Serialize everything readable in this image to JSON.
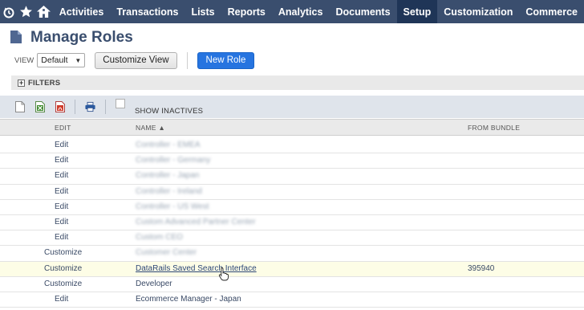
{
  "nav": {
    "items": [
      {
        "label": "Activities",
        "active": false
      },
      {
        "label": "Transactions",
        "active": false
      },
      {
        "label": "Lists",
        "active": false
      },
      {
        "label": "Reports",
        "active": false
      },
      {
        "label": "Analytics",
        "active": false
      },
      {
        "label": "Documents",
        "active": false
      },
      {
        "label": "Setup",
        "active": true
      },
      {
        "label": "Customization",
        "active": false
      },
      {
        "label": "Commerce",
        "active": false
      }
    ],
    "icons": [
      "recent-records-icon",
      "star-icon",
      "home-icon"
    ],
    "colors": {
      "bar": "#3a4e6e",
      "active": "#1f3557"
    }
  },
  "page": {
    "title": "Manage Roles"
  },
  "controls": {
    "view_label": "VIEW",
    "view_value": "Default",
    "customize_view_label": "Customize View",
    "new_role_label": "New Role"
  },
  "filters": {
    "label": "FILTERS"
  },
  "toolbar": {
    "icons": [
      "new-document-icon",
      "excel-export-icon",
      "pdf-export-icon",
      "print-icon"
    ],
    "show_inactives_label": "SHOW INACTIVES",
    "show_inactives_checked": false
  },
  "table": {
    "headers": {
      "edit": "EDIT",
      "name": "NAME ▲",
      "from_bundle": "FROM BUNDLE"
    },
    "rows": [
      {
        "action": "Edit",
        "name": "Controller - EMEA",
        "bundle": "",
        "blurred": true
      },
      {
        "action": "Edit",
        "name": "Controller - Germany",
        "bundle": "",
        "blurred": true
      },
      {
        "action": "Edit",
        "name": "Controller - Japan",
        "bundle": "",
        "blurred": true
      },
      {
        "action": "Edit",
        "name": "Controller - Ireland",
        "bundle": "",
        "blurred": true
      },
      {
        "action": "Edit",
        "name": "Controller - US West",
        "bundle": "",
        "blurred": true
      },
      {
        "action": "Edit",
        "name": "Custom Advanced Partner Center",
        "bundle": "",
        "blurred": true
      },
      {
        "action": "Edit",
        "name": "Custom CEO",
        "bundle": "",
        "blurred": true
      },
      {
        "action": "Customize",
        "name": "Customer Center",
        "bundle": "",
        "blurred": true
      },
      {
        "action": "Customize",
        "name": "DataRails Saved Search Interface",
        "bundle": "395940",
        "blurred": false,
        "highlight": true
      },
      {
        "action": "Customize",
        "name": "Developer",
        "bundle": "",
        "blurred": false
      },
      {
        "action": "Edit",
        "name": "Ecommerce Manager - Japan",
        "bundle": "",
        "blurred": false
      }
    ]
  }
}
